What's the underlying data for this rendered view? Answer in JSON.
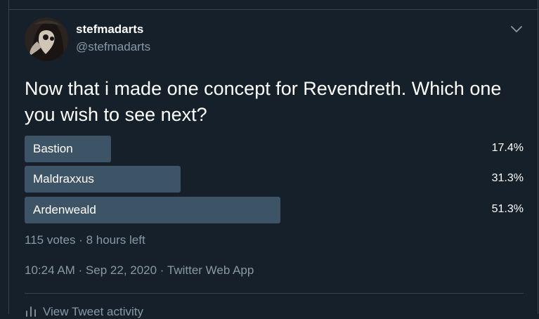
{
  "tweet": {
    "author_name": "stefmadarts",
    "author_handle": "@stefmadarts",
    "text": "Now that i made one concept for Revendreth. Which one you wish to see next?",
    "timestamp": "10:24 AM · Sep 22, 2020 · Twitter Web App",
    "activity_label": "View Tweet activity"
  },
  "poll": {
    "options": [
      {
        "label": "Bastion",
        "percent": "17.4%",
        "fraction": 0.174
      },
      {
        "label": "Maldraxxus",
        "percent": "31.3%",
        "fraction": 0.313
      },
      {
        "label": "Ardenweald",
        "percent": "51.3%",
        "fraction": 0.513
      }
    ],
    "meta": "115 votes · 8 hours left"
  },
  "icons": {
    "more": "chevron-down-icon",
    "activity": "bar-chart-icon",
    "avatar": "plague-doctor-avatar"
  },
  "colors": {
    "background": "#15202b",
    "poll_bar": "#3d5466",
    "secondary_text": "#8899a6",
    "border": "#38444d"
  }
}
